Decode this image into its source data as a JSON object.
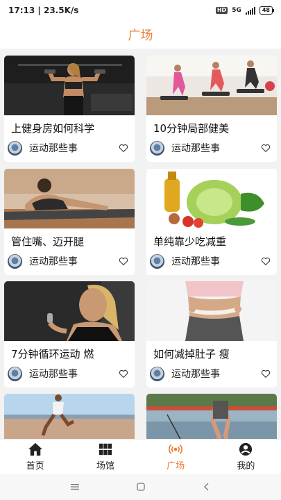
{
  "status": {
    "time": "17:13",
    "speed": "23.5K/s",
    "separator": "|",
    "hd": "HD",
    "network": "5G",
    "battery": "48"
  },
  "header": {
    "title": "广场"
  },
  "cards": [
    {
      "title": "上健身房如何科学",
      "author": "运动那些事",
      "image": "gym-woman-dumbbells"
    },
    {
      "title": "10分钟局部健美",
      "author": "运动那些事",
      "image": "step-aerobics-class"
    },
    {
      "title": "管住嘴、迈开腿",
      "author": "运动那些事",
      "image": "woman-stretching-mat"
    },
    {
      "title": "单纯靠少吃减重",
      "author": "运动那些事",
      "image": "vegetables-cabbage-oil"
    },
    {
      "title": "7分钟循环运动 燃",
      "author": "运动那些事",
      "image": "woman-sweating-drinking"
    },
    {
      "title": "如何减掉肚子 瘦",
      "author": "运动那些事",
      "image": "waist-measuring-tape"
    },
    {
      "title": "",
      "author": "",
      "image": "runner-track"
    },
    {
      "title": "",
      "author": "",
      "image": "jump-rope-outdoor"
    }
  ],
  "tabbar": [
    {
      "label": "首页",
      "icon": "home-icon",
      "active": false
    },
    {
      "label": "场馆",
      "icon": "grid-icon",
      "active": false
    },
    {
      "label": "广场",
      "icon": "broadcast-icon",
      "active": true
    },
    {
      "label": "我的",
      "icon": "user-icon",
      "active": false
    }
  ],
  "colors": {
    "accent": "#f07a36",
    "background": "#f2f2f2"
  }
}
